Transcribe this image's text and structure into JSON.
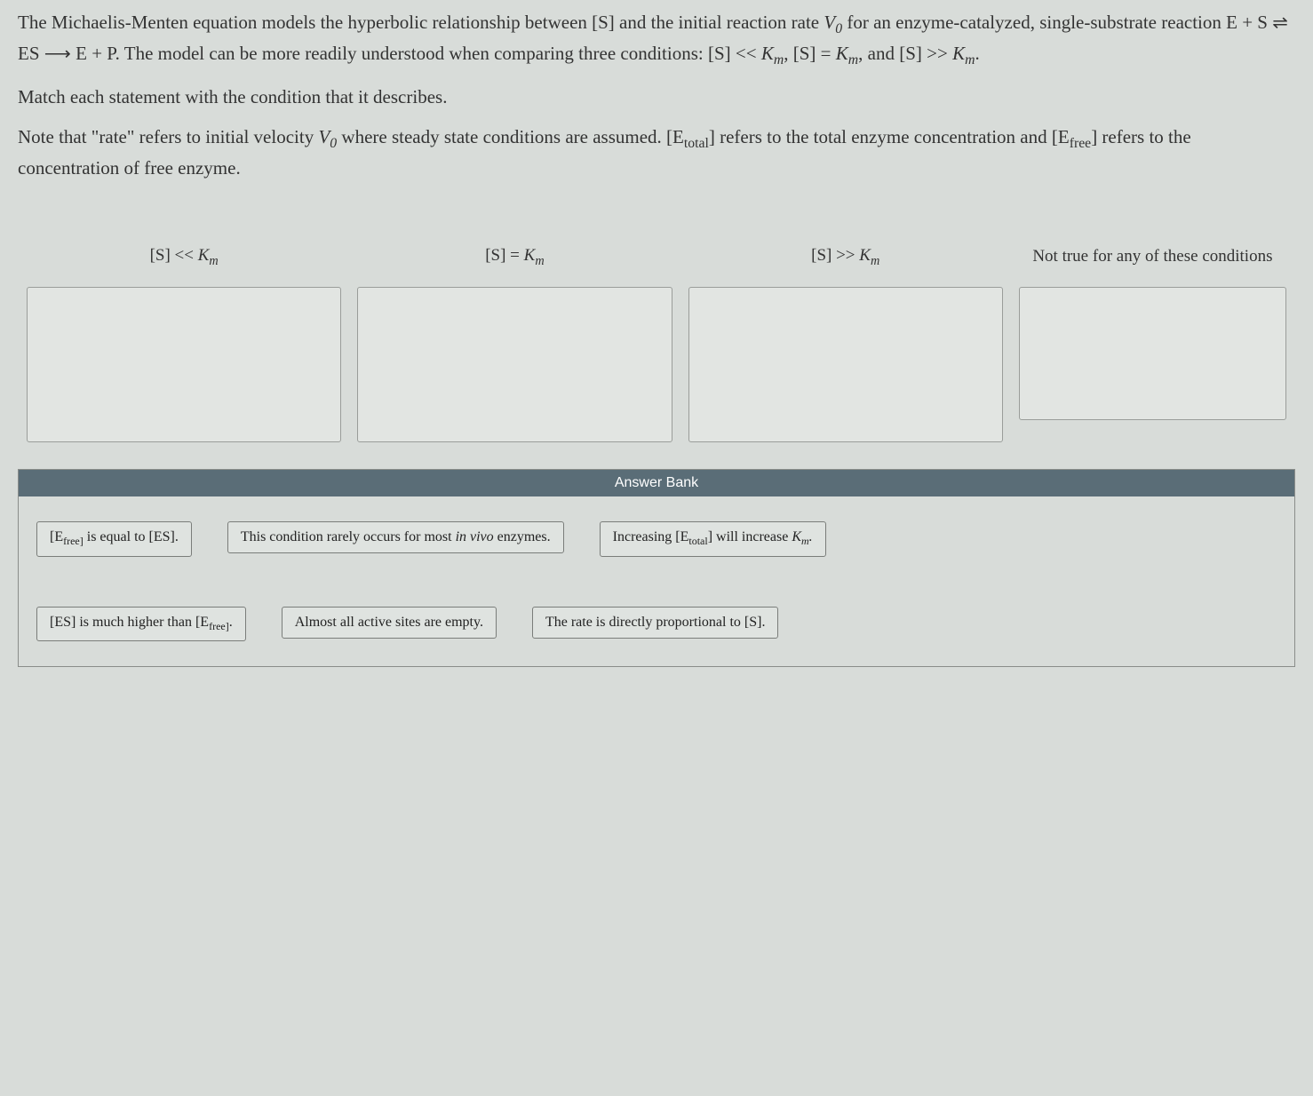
{
  "question": {
    "p1_a": "The Michaelis-Menten equation models the hyperbolic relationship between [S] and the initial reaction rate ",
    "p1_b": " for an enzyme-catalyzed, single-substrate reaction E + S ⇌ ES ⟶ E + P. The model can be more readily understood when comparing three conditions: [S] << ",
    "p1_c": ", [S] = ",
    "p1_d": ", and [S] >> ",
    "p1_e": ".",
    "p2": "Match each statement with the condition that it describes.",
    "p3_a": "Note that \"rate\" refers to initial velocity ",
    "p3_b": " where steady state conditions are assumed. [E",
    "p3_c": "] refers to the total enzyme concentration and [E",
    "p3_d": "] refers to the concentration of free enzyme."
  },
  "zones": {
    "z1_a": "[S] << ",
    "z2_a": "[S] = ",
    "z3_a": "[S] >> ",
    "z4": "Not true for any of these conditions"
  },
  "bank": {
    "header": "Answer Bank",
    "a1_a": "[E",
    "a1_b": " is equal to [ES].",
    "a2_a": "This condition rarely occurs for most ",
    "a2_b": "in vivo",
    "a2_c": " enzymes.",
    "a3_a": "Increasing [E",
    "a3_b": " will increase ",
    "a4_a": "[ES] is much higher than [E",
    "a4_b": ".",
    "a5": "Almost all active sites are empty.",
    "a6": "The rate is directly proportional to [S]."
  },
  "sym": {
    "V0_v": "V",
    "V0_0": "0",
    "Km_k": "K",
    "Km_m": "m",
    "total": "total",
    "free": "free",
    "freed": "free]"
  }
}
